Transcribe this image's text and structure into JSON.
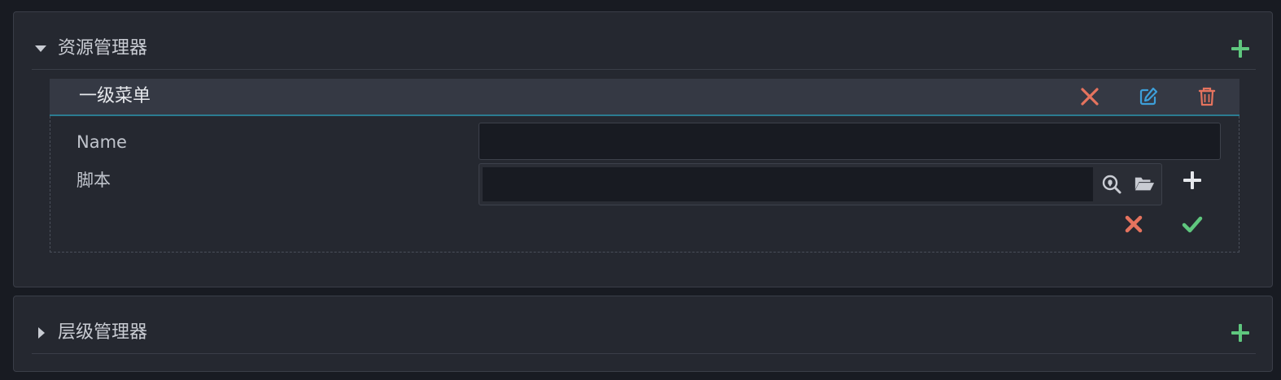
{
  "colors": {
    "background": "#181b22",
    "panel": "#252830",
    "accent_green": "#5fc77e",
    "accent_red": "#e5735e",
    "accent_blue": "#3d9fd9",
    "header_underline": "#2b7c91"
  },
  "panels": {
    "resources": {
      "title": "资源管理器",
      "expanded": true,
      "add_icon": "plus-icon"
    },
    "hierarchy": {
      "title": "层级管理器",
      "expanded": false,
      "add_icon": "plus-icon"
    }
  },
  "menu": {
    "title": "一级菜单",
    "actions": [
      "close-icon",
      "edit-icon",
      "trash-icon"
    ],
    "fields": {
      "name_label": "Name",
      "name_value": "",
      "script_label": "脚本",
      "script_value": ""
    },
    "script_actions": [
      "locate-icon",
      "folder-open-icon",
      "plus-icon"
    ],
    "form_actions": [
      "cancel-icon",
      "confirm-icon"
    ]
  }
}
